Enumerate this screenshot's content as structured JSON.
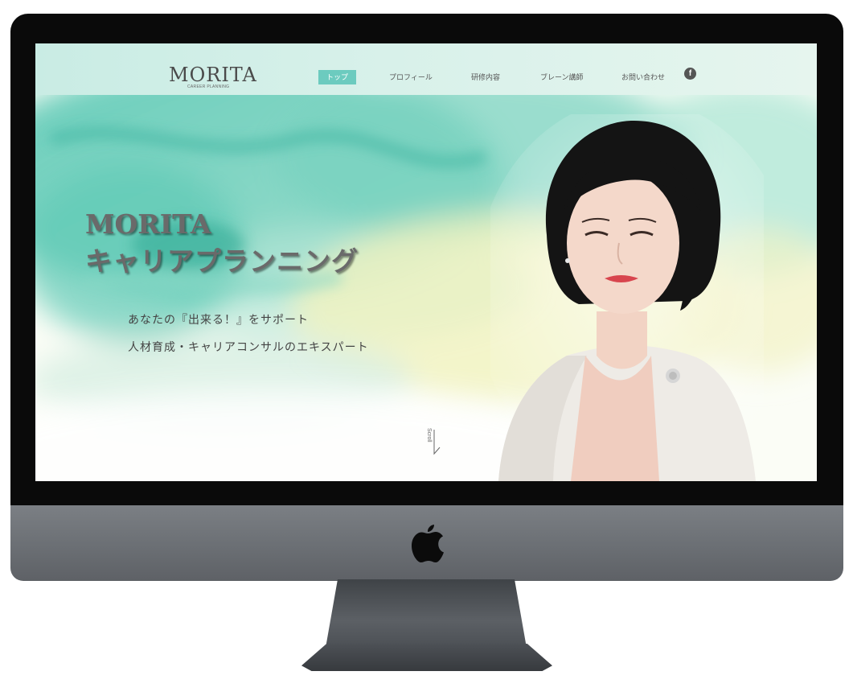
{
  "site": {
    "logo_text": "MORITA",
    "logo_subtitle": "CAREER PLANNING"
  },
  "nav": {
    "items": [
      {
        "label": "トップ",
        "active": true
      },
      {
        "label": "プロフィール",
        "active": false
      },
      {
        "label": "研修内容",
        "active": false
      },
      {
        "label": "ブレーン講師",
        "active": false
      },
      {
        "label": "お問い合わせ",
        "active": false
      }
    ],
    "social_icon": "facebook-icon",
    "social_glyph": "f"
  },
  "hero": {
    "title_en": "MORITA",
    "title_ja": "キャリアプランニング",
    "tagline_1": "あなたの『出来る！』をサポート",
    "tagline_2": "人材育成・キャリアコンサルのエキスパート",
    "scroll_label": "Scroll"
  },
  "colors": {
    "accent": "#6ccbbf",
    "nav_bg": "#d2efe8",
    "text_dark": "#444444",
    "title_gray": "#6a6a6a",
    "bezel": "#0a0a0a",
    "chin": "#6e7277"
  }
}
